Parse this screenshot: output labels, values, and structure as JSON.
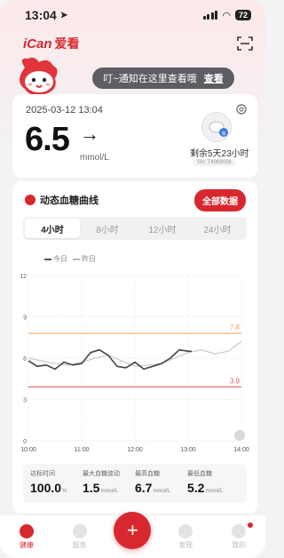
{
  "status": {
    "time": "13:04",
    "battery": "72"
  },
  "header": {
    "logo_text": "iCan",
    "logo_cn": "爱看",
    "scan_icon": "scan-icon"
  },
  "notice": {
    "text": "叮~通知在这里查看哦",
    "link": "查看"
  },
  "reading": {
    "datetime": "2025-03-12 13:04",
    "value": "6.5",
    "trend": "→",
    "unit": "mmol/L",
    "remaining": "剩余5天23小时",
    "sn": "SN: T4069026"
  },
  "curve": {
    "title": "动态血糖曲线",
    "all_data_button": "全部数据",
    "tabs": [
      "4小时",
      "8小时",
      "12小时",
      "24小时"
    ],
    "active_tab": 0,
    "legend_today": "今日",
    "legend_yesterday": "昨日"
  },
  "chart_data": {
    "type": "line",
    "y_ticks": [
      "0",
      "3",
      "6",
      "9",
      "12"
    ],
    "x_ticks": [
      "10:00",
      "11:00",
      "12:00",
      "13:00",
      "14:00"
    ],
    "ylim": [
      0,
      12
    ],
    "xlim": [
      "10:00",
      "14:00"
    ],
    "upper_threshold": 7.8,
    "lower_threshold": 3.9,
    "upper_label": "7.8",
    "lower_label": "3.9",
    "colors": {
      "today": "#444444",
      "yesterday": "#c8c8c8",
      "upper": "#f2a35a",
      "lower": "#e0595a"
    },
    "series": [
      {
        "name": "今日",
        "x": [
          "10:00",
          "10:10",
          "10:20",
          "10:30",
          "10:40",
          "10:50",
          "11:00",
          "11:10",
          "11:20",
          "11:30",
          "11:40",
          "11:50",
          "12:00",
          "12:10",
          "12:20",
          "12:30",
          "12:40",
          "12:50",
          "13:00",
          "13:04"
        ],
        "values": [
          5.8,
          5.4,
          5.5,
          5.2,
          5.7,
          5.5,
          5.6,
          6.4,
          6.6,
          6.2,
          5.4,
          5.3,
          5.7,
          5.2,
          5.4,
          5.6,
          6.0,
          6.6,
          6.5,
          6.5
        ]
      },
      {
        "name": "昨日",
        "x": [
          "10:00",
          "10:15",
          "10:30",
          "10:45",
          "11:00",
          "11:15",
          "11:30",
          "11:45",
          "12:00",
          "12:15",
          "12:30",
          "12:45",
          "13:00",
          "13:15",
          "13:30",
          "13:45",
          "14:00"
        ],
        "values": [
          6.0,
          5.8,
          5.6,
          5.5,
          5.7,
          6.0,
          6.2,
          5.8,
          5.4,
          5.5,
          5.6,
          6.0,
          6.4,
          6.6,
          6.3,
          6.5,
          7.2
        ]
      }
    ]
  },
  "stats": [
    {
      "label": "达标时间",
      "value": "100.0",
      "unit": "%"
    },
    {
      "label": "最大血糖波动",
      "value": "1.5",
      "unit": "mmol/L"
    },
    {
      "label": "最高血糖",
      "value": "6.7",
      "unit": "mmol/L"
    },
    {
      "label": "最低血糖",
      "value": "5.2",
      "unit": "mmol/L"
    }
  ],
  "tabbar": {
    "home": "健康",
    "service": "服务",
    "discover": "发现",
    "mine": "我的"
  }
}
